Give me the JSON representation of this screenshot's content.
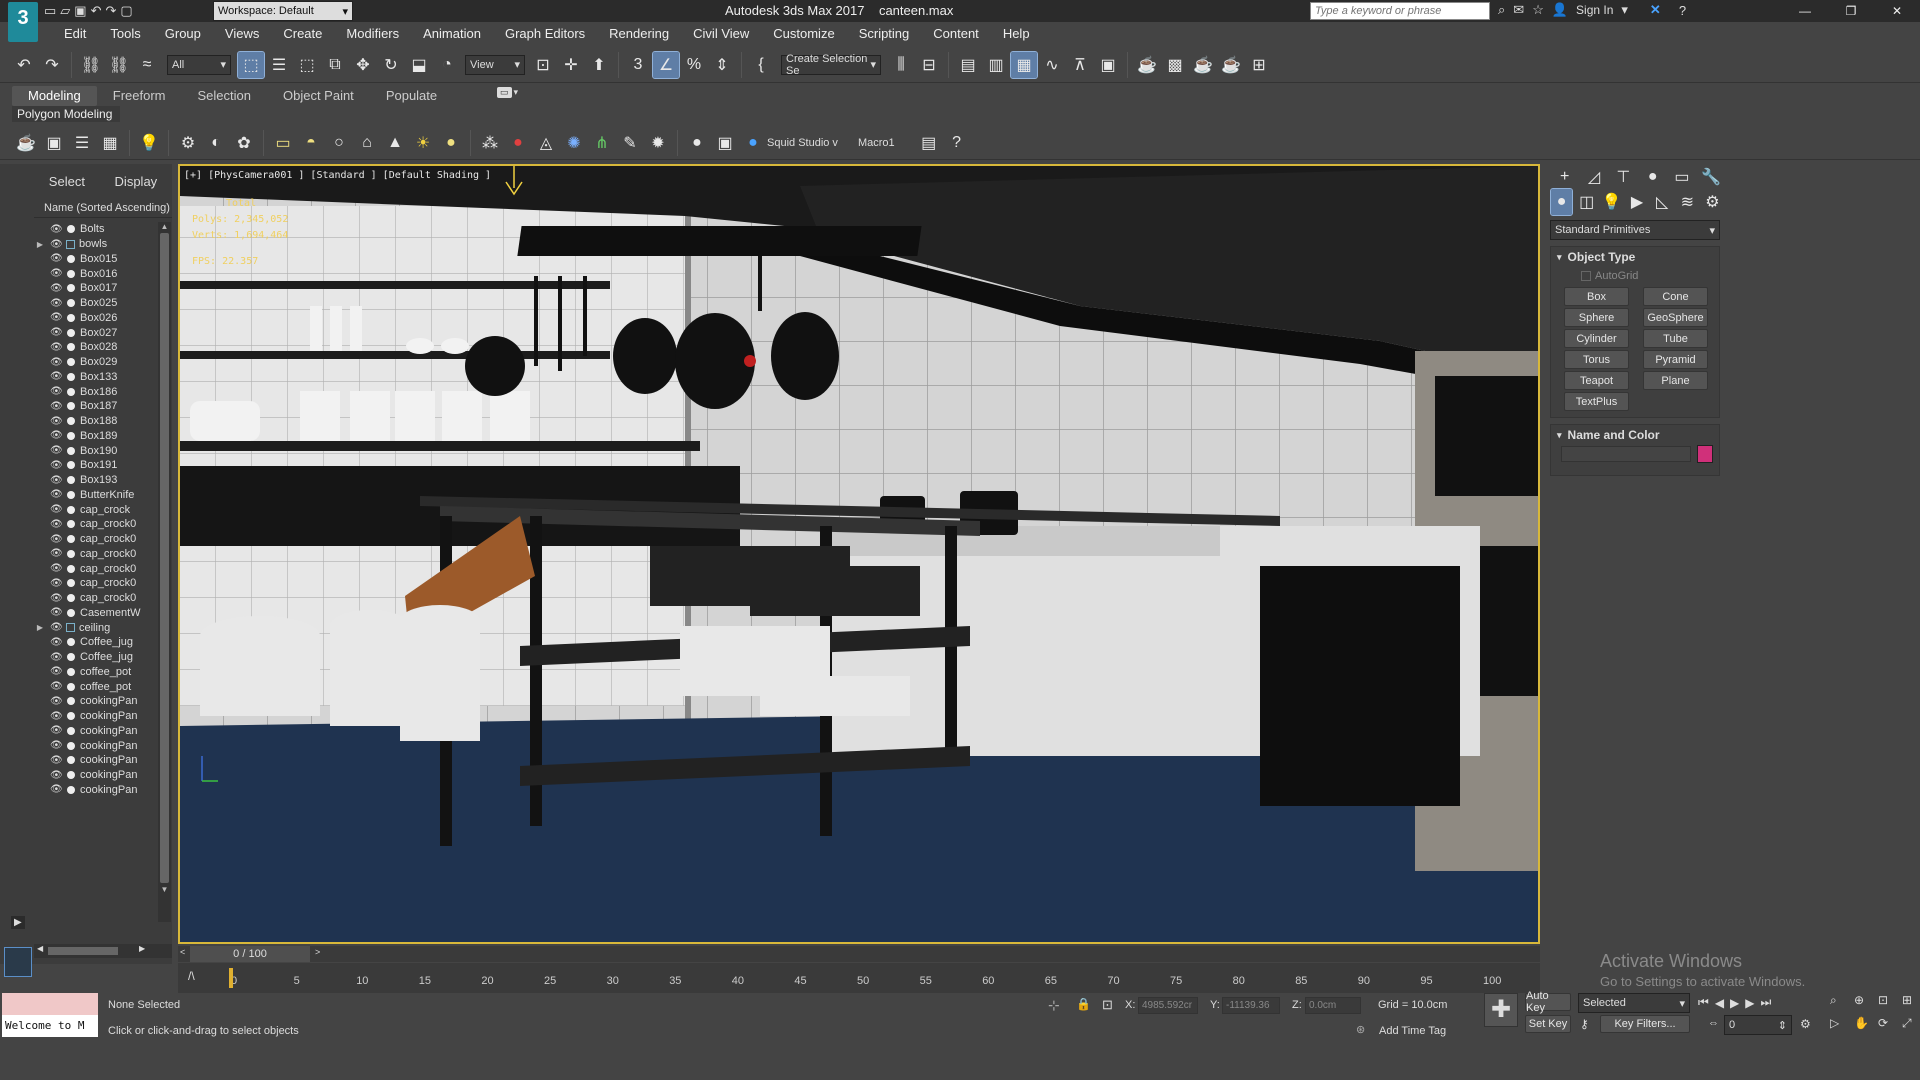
{
  "title_bar": {
    "workspace": "Workspace: Default",
    "app_title": "Autodesk 3ds Max 2017",
    "file_name": "canteen.max",
    "search_placeholder": "Type a keyword or phrase",
    "sign_in": "Sign In"
  },
  "menu": [
    "Edit",
    "Tools",
    "Group",
    "Views",
    "Create",
    "Modifiers",
    "Animation",
    "Graph Editors",
    "Rendering",
    "Civil View",
    "Customize",
    "Scripting",
    "Content",
    "Help"
  ],
  "main_toolbar": {
    "filter": "All",
    "ref_coord": "View",
    "selection_set": "Create Selection Se"
  },
  "ribbon": {
    "tabs": [
      "Modeling",
      "Freeform",
      "Selection",
      "Object Paint",
      "Populate"
    ],
    "active_tab": "Modeling",
    "sub_label": "Polygon Modeling"
  },
  "secondary_toolbar": {
    "plugin_label": "Squid Studio v",
    "macro_label": "Macro1"
  },
  "scene_explorer": {
    "tabs": [
      "Select",
      "Display"
    ],
    "column_header": "Name (Sorted Ascending)",
    "items": [
      {
        "name": "Bolts",
        "group": false
      },
      {
        "name": "bowls",
        "group": true
      },
      {
        "name": "Box015",
        "group": false
      },
      {
        "name": "Box016",
        "group": false
      },
      {
        "name": "Box017",
        "group": false
      },
      {
        "name": "Box025",
        "group": false
      },
      {
        "name": "Box026",
        "group": false
      },
      {
        "name": "Box027",
        "group": false
      },
      {
        "name": "Box028",
        "group": false
      },
      {
        "name": "Box029",
        "group": false
      },
      {
        "name": "Box133",
        "group": false
      },
      {
        "name": "Box186",
        "group": false
      },
      {
        "name": "Box187",
        "group": false
      },
      {
        "name": "Box188",
        "group": false
      },
      {
        "name": "Box189",
        "group": false
      },
      {
        "name": "Box190",
        "group": false
      },
      {
        "name": "Box191",
        "group": false
      },
      {
        "name": "Box193",
        "group": false
      },
      {
        "name": "ButterKnife",
        "group": false
      },
      {
        "name": "cap_crock",
        "group": false
      },
      {
        "name": "cap_crock0",
        "group": false
      },
      {
        "name": "cap_crock0",
        "group": false
      },
      {
        "name": "cap_crock0",
        "group": false
      },
      {
        "name": "cap_crock0",
        "group": false
      },
      {
        "name": "cap_crock0",
        "group": false
      },
      {
        "name": "cap_crock0",
        "group": false
      },
      {
        "name": "CasementW",
        "group": false
      },
      {
        "name": "ceiling",
        "group": true
      },
      {
        "name": "Coffee_jug",
        "group": false
      },
      {
        "name": "Coffee_jug",
        "group": false
      },
      {
        "name": "coffee_pot",
        "group": false
      },
      {
        "name": "coffee_pot",
        "group": false
      },
      {
        "name": "cookingPan",
        "group": false
      },
      {
        "name": "cookingPan",
        "group": false
      },
      {
        "name": "cookingPan",
        "group": false
      },
      {
        "name": "cookingPan",
        "group": false
      },
      {
        "name": "cookingPan",
        "group": false
      },
      {
        "name": "cookingPan",
        "group": false
      },
      {
        "name": "cookingPan",
        "group": false
      }
    ]
  },
  "viewport": {
    "label": "[+] [PhysCamera001 ] [Standard ] [Default Shading ]",
    "stats_header": "Total",
    "polys_label": "Polys:",
    "polys_value": "2,345,052",
    "verts_label": "Verts:",
    "verts_value": "1,694,464",
    "fps_label": "FPS:",
    "fps_value": "22.357"
  },
  "command_panel": {
    "category": "Standard Primitives",
    "object_type_title": "Object Type",
    "autogrid": "AutoGrid",
    "buttons": [
      "Box",
      "Cone",
      "Sphere",
      "GeoSphere",
      "Cylinder",
      "Tube",
      "Torus",
      "Pyramid",
      "Teapot",
      "Plane",
      "TextPlus"
    ],
    "name_color_title": "Name and Color",
    "name_value": "",
    "color": "#d0307a"
  },
  "timeline": {
    "frame_display": "0 / 100",
    "ticks": [
      "0",
      "5",
      "10",
      "15",
      "20",
      "25",
      "30",
      "35",
      "40",
      "45",
      "50",
      "55",
      "60",
      "65",
      "70",
      "75",
      "80",
      "85",
      "90",
      "95",
      "100"
    ]
  },
  "status": {
    "maxscript": "Welcome to M",
    "selection": "None Selected",
    "prompt": "Click or click-and-drag to select objects",
    "x_label": "X:",
    "x_value": "4985.592cr",
    "y_label": "Y:",
    "y_value": "-11139.36",
    "z_label": "Z:",
    "z_value": "0.0cm",
    "grid": "Grid = 10.0cm",
    "add_time_tag": "Add Time Tag",
    "auto_key": "Auto Key",
    "set_key": "Set Key",
    "key_mode": "Selected",
    "key_filters": "Key Filters...",
    "frame_value": "0"
  },
  "watermark": {
    "line1": "Activate Windows",
    "line2": "Go to Settings to activate Windows."
  }
}
